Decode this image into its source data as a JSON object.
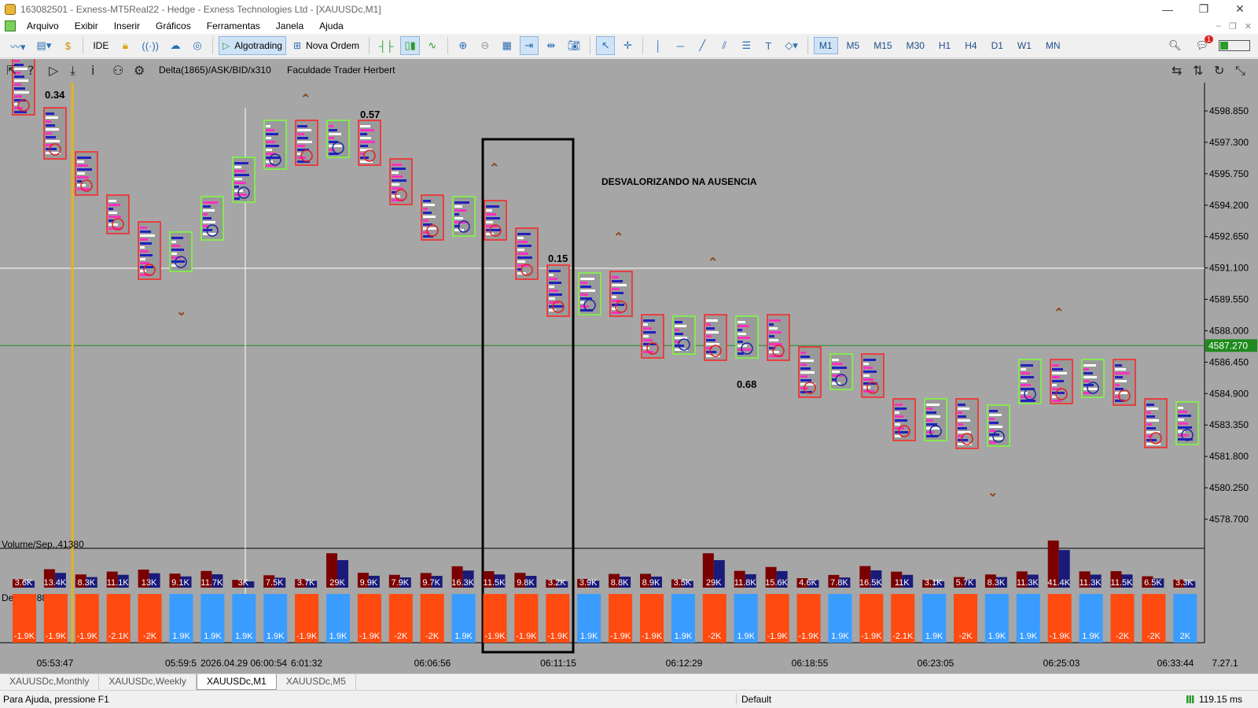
{
  "window": {
    "title": "163082501 - Exness-MT5Real22 - Hedge - Exness Technologies Ltd - [XAUUSDc,M1]",
    "minimize": "—",
    "maximize": "❐",
    "close": "✕"
  },
  "menu": {
    "items": [
      {
        "label": "Arquivo"
      },
      {
        "label": "Exibir"
      },
      {
        "label": "Inserir"
      },
      {
        "label": "Gráficos"
      },
      {
        "label": "Ferramentas"
      },
      {
        "label": "Janela"
      },
      {
        "label": "Ajuda"
      }
    ],
    "right": [
      "–",
      "❐",
      "✕"
    ]
  },
  "toolbar": {
    "ide_label": "IDE",
    "algotrading_label": "Algotrading",
    "new_order_label": "Nova Ordem",
    "timeframes": [
      "M1",
      "M5",
      "M15",
      "M30",
      "H1",
      "H4",
      "D1",
      "W1",
      "MN"
    ],
    "selected_timeframe": "M1",
    "notification_count": "1"
  },
  "chart": {
    "indicator_title": "Delta(1865)/ASK/BID/x310",
    "author_label": "Faculdade Trader Herbert",
    "annotation": "DESVALORIZANDO NA AUSENCIA",
    "value_labels": [
      "0.34",
      "0.57",
      "0.15",
      "0.68"
    ],
    "current_price": "4587.270",
    "price_ticks": [
      "4598.850",
      "4597.300",
      "4595.750",
      "4594.200",
      "4592.650",
      "4591.100",
      "4589.550",
      "4588.000",
      "4586.450",
      "4584.900",
      "4583.350",
      "4581.800",
      "4580.250",
      "4578.700"
    ],
    "volume_title": "Volume/Sep.,41380",
    "delta_title": "Delta,2088",
    "volume_labels": [
      "3.6K",
      "13.4K",
      "8.3K",
      "11.1K",
      "13K",
      "9.1K",
      "11.7K",
      "3K",
      "7.5K",
      "3.7K",
      "29K",
      "9.9K",
      "7.9K",
      "9.7K",
      "16.3K",
      "11.5K",
      "9.8K",
      "3.2K",
      "3.9K",
      "8.8K",
      "8.9K",
      "3.5K",
      "29K",
      "11.8K",
      "15.6K",
      "4.6K",
      "7.8K",
      "16.5K",
      "11K",
      "3.1K",
      "5.7K",
      "8.3K",
      "11.3K",
      "41.4K",
      "11.3K",
      "11.5K",
      "6.5K",
      "3.3K"
    ],
    "delta_labels": [
      "-1.9K",
      "-1.9K",
      "-1.9K",
      "-2.1K",
      "-2K",
      "1.9K",
      "1.9K",
      "1.9K",
      "1.9K",
      "-1.9K",
      "1.9K",
      "-1.9K",
      "-2K",
      "-2K",
      "1.9K",
      "-1.9K",
      "-1.9K",
      "-1.9K",
      "1.9K",
      "-1.9K",
      "-1.9K",
      "1.9K",
      "-2K",
      "1.9K",
      "-1.9K",
      "-1.9K",
      "1.9K",
      "-1.9K",
      "-2.1K",
      "1.9K",
      "-2K",
      "1.9K",
      "1.9K",
      "-1.9K",
      "1.9K",
      "-2K",
      "-2K",
      "2K"
    ],
    "time_labels": [
      "05:53:47",
      "05:59:5",
      "2026.04.29 06:00:54",
      "6:01:32",
      "06:06:56",
      "06:11:15",
      "06:12:29",
      "06:18:55",
      "06:23:05",
      "06:25:03",
      "06:33:44"
    ],
    "version": "7.27.1",
    "colors": {
      "background": "#a6a6a6",
      "bear_box": "#ff2020",
      "bull_box": "#7dff3a",
      "bar_sell": "#ff4a10",
      "bar_buy": "#3a9cff",
      "price_line": "#1e8a1e"
    }
  },
  "tabs": {
    "items": [
      "XAUUSDc,Monthly",
      "XAUUSDc,Weekly",
      "XAUUSDc,M1",
      "XAUUSDc,M5"
    ],
    "active": "XAUUSDc,M1"
  },
  "status": {
    "help": "Para Ajuda, pressione F1",
    "profile": "Default",
    "ping": "119.15 ms"
  }
}
